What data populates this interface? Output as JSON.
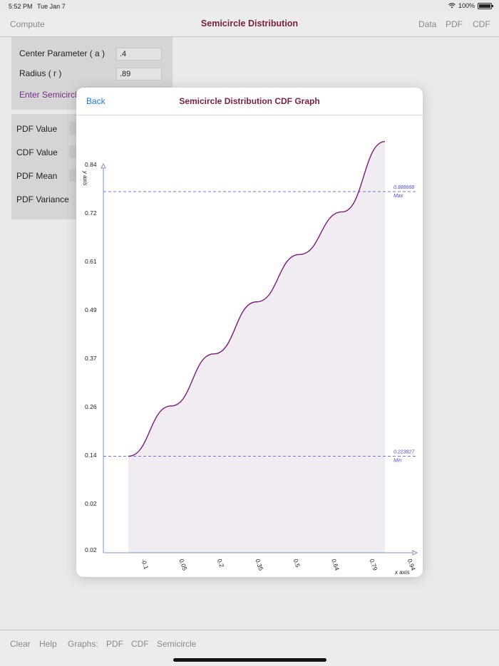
{
  "status_bar": {
    "time": "5:52 PM",
    "date": "Tue Jan 7",
    "battery": "100%",
    "battery_level": 1.0
  },
  "nav": {
    "left": "Compute",
    "title": "Semicircle Distribution",
    "right_items": [
      "Data",
      "PDF",
      "CDF"
    ]
  },
  "form": {
    "center_label": "Center Parameter ( a  )",
    "center_value": ".4",
    "radius_label": "Radius ( r )",
    "radius_value": ".89",
    "enter_label": "Enter Semicircle",
    "results": [
      "PDF Value",
      "CDF Value",
      "PDF Mean",
      "PDF Variance"
    ]
  },
  "toolbar": {
    "items": [
      "Clear",
      "Help",
      "Graphs:",
      "PDF",
      "CDF",
      "Semicircle"
    ]
  },
  "modal": {
    "back": "Back",
    "title": "Semicircle Distribution CDF Graph"
  },
  "chart_data": {
    "type": "line",
    "title": "Semicircle Distribution CDF Graph",
    "xlabel": "x axis",
    "ylabel": "y axis",
    "x_ticks": [
      "-0.1",
      "0.05",
      "0.2",
      "0.35",
      "0.5",
      "0.64",
      "0.79",
      "0.94"
    ],
    "y_ticks": [
      "0.02",
      "0.02",
      "0.14",
      "0.26",
      "0.37",
      "0.49",
      "0.61",
      "0.72",
      "0.84"
    ],
    "xlim": [
      -0.2,
      0.94
    ],
    "ylim": [
      0.02,
      0.84
    ],
    "x": [
      -0.1,
      0.05,
      0.2,
      0.35,
      0.5,
      0.64,
      0.79
    ],
    "y": [
      0.223827,
      0.33,
      0.44,
      0.55,
      0.65,
      0.74,
      0.888668
    ],
    "max_line": {
      "value": "0.888668",
      "label": "Max"
    },
    "min_line": {
      "value": "0.223827",
      "label": "Min"
    },
    "line_color": "#7a1a7a",
    "fill_color": "#f0ecf2",
    "ref_line_color": "#4a4adf"
  }
}
